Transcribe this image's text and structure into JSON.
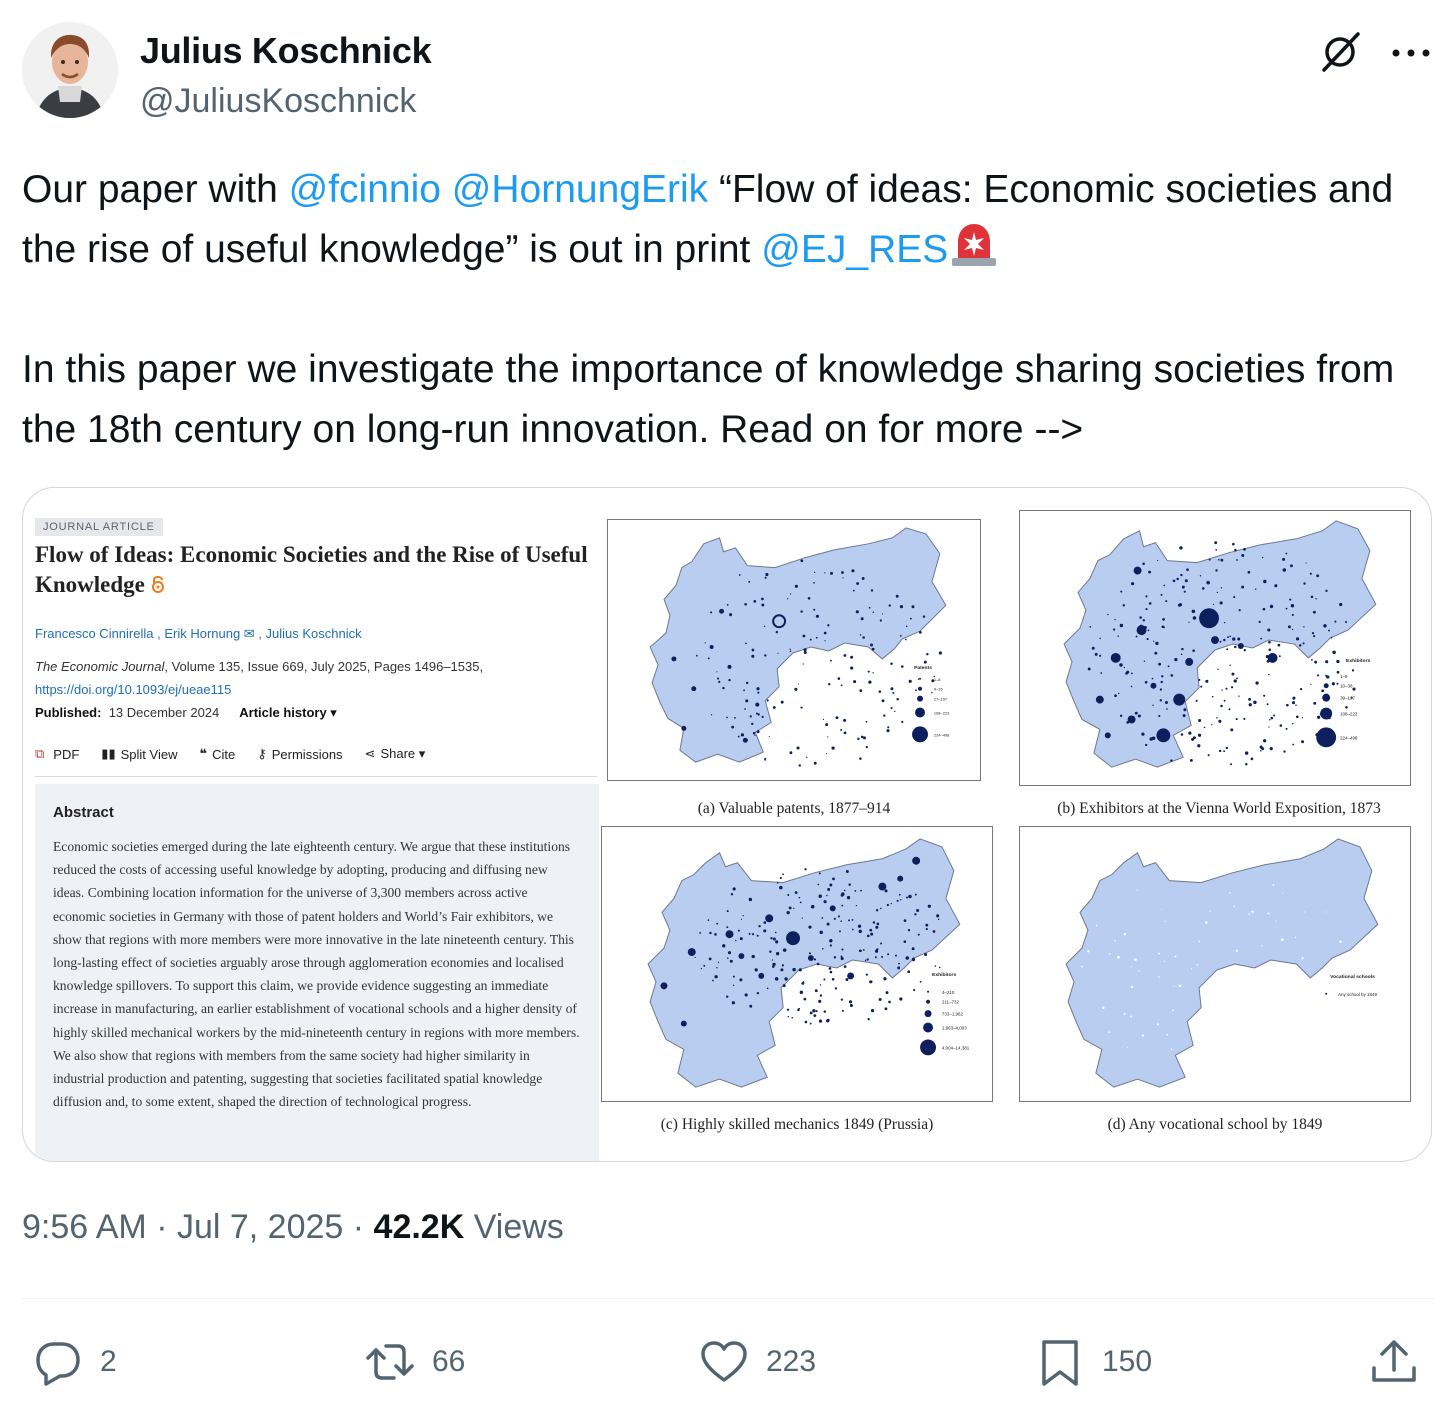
{
  "author": {
    "name": "Julius Koschnick",
    "handle": "@JuliusKoschnick"
  },
  "tweet": {
    "line1_prefix": "Our paper with ",
    "mention1": "@fcinnio",
    "mention2": "@HornungErik",
    "line1_title": " “Flow of ideas: Economic societies and the rise of useful knowledge” is out in print ",
    "mention3": "@EJ_RES",
    "para2": "In this paper we investigate the importance of knowledge sharing societies from the 18th century on long-run innovation. Read on for more -->"
  },
  "article": {
    "tag": "JOURNAL ARTICLE",
    "title": "Flow of Ideas: Economic Societies and the Rise of Useful Knowledge",
    "authors": "Francesco Cinnirella , Erik Hornung ✉ , Julius Koschnick",
    "journal_name": "The Economic Journal",
    "journal_details": ", Volume 135, Issue 669, July 2025, Pages 1496–1535,",
    "doi": "https://doi.org/10.1093/ej/ueae115",
    "published_label": "Published:",
    "published_date": "13 December 2024",
    "history": "Article history ▾",
    "tools": {
      "pdf": "PDF",
      "split": "Split View",
      "cite": "Cite",
      "permissions": "Permissions",
      "share": "Share ▾"
    },
    "abstract_heading": "Abstract",
    "abstract_text": "Economic societies emerged during the late eighteenth century. We argue that these institutions reduced the costs of accessing useful knowledge by adopting, producing and diffusing new ideas. Combining location information for the universe of 3,300 members across active economic societies in Germany with those of patent holders and World’s Fair exhibitors, we show that regions with more members were more innovative in the late nineteenth century. This long-lasting effect of societies arguably arose through agglomeration economies and localised knowledge spillovers. To support this claim, we provide evidence suggesting an immediate increase in manufacturing, an earlier establishment of vocational schools and a higher density of highly skilled mechanical workers by the mid-nineteenth century in regions with more members. We also show that regions with members from the same society had higher similarity in industrial production and patenting, suggesting that societies facilitated spatial knowledge diffusion and, to some extent, shaped the direction of technological progress."
  },
  "maps": {
    "a": {
      "caption": "(a) Valuable patents, 1877–914",
      "legend_title": "Patents",
      "legend": [
        "1–8",
        "9–26",
        "27–107",
        "108–223",
        "224–498"
      ]
    },
    "b": {
      "caption": "(b) Exhibitors at the Vienna World Exposition, 1873",
      "legend_title": "Exhibitors",
      "legend": [
        "1–9",
        "10–38",
        "39–107",
        "108–223",
        "224–498"
      ]
    },
    "c": {
      "caption": "(c) Highly skilled mechanics 1849 (Prussia)",
      "legend_title": "Exhibitors",
      "legend": [
        "4–210",
        "211–732",
        "733–1,962",
        "1,963–4,003",
        "4,004–14,381"
      ]
    },
    "d": {
      "caption": "(d) Any vocational school by 1849",
      "legend_title": "Vocational schools",
      "legend": [
        "Any school by 1849"
      ]
    },
    "land_color": "#b9cdf0",
    "dot_color": "#0d1f5c"
  },
  "meta": {
    "time": "9:56 AM",
    "sep1": " · ",
    "date": "Jul 7, 2025",
    "sep2": " · ",
    "views_count": "42.2K",
    "views_label": " Views"
  },
  "actions": {
    "replies": "2",
    "reposts": "66",
    "likes": "223",
    "bookmarks": "150"
  },
  "colors": {
    "accent": "#1d9bf0",
    "muted": "#536471",
    "text": "#0f1419"
  }
}
